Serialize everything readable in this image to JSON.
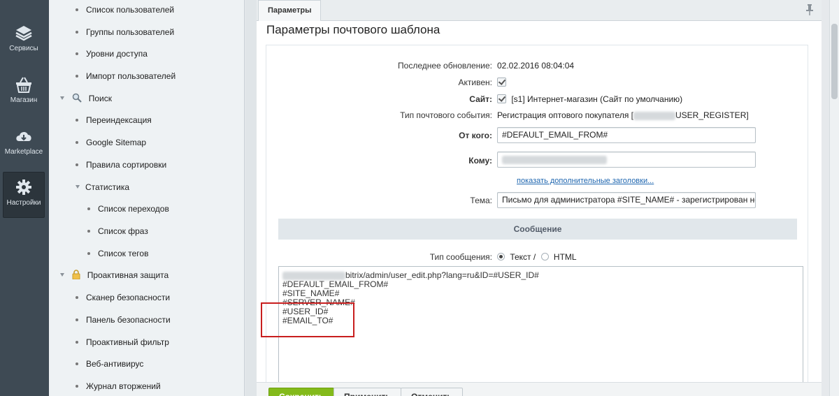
{
  "rail": [
    {
      "label": "Сервисы",
      "icon": "layers-icon"
    },
    {
      "label": "Магазин",
      "icon": "basket-icon"
    },
    {
      "label": "Marketplace",
      "icon": "cloud-download-icon"
    },
    {
      "label": "Настройки",
      "icon": "gear-icon",
      "active": true
    }
  ],
  "menu": [
    "Список пользователей",
    "Группы пользователей",
    "Уровни доступа",
    "Импорт пользователей",
    "Поиск",
    "Переиндексация",
    "Google Sitemap",
    "Правила сортировки",
    "Статистика",
    "Список переходов",
    "Список фраз",
    "Список тегов",
    "Проактивная защита",
    "Сканер безопасности",
    "Панель безопасности",
    "Проактивный фильтр",
    "Веб-антивирус",
    "Журнал вторжений"
  ],
  "tab": {
    "label": "Параметры"
  },
  "form": {
    "title": "Параметры почтового шаблона",
    "last_update_label": "Последнее обновление:",
    "last_update_value": "02.02.2016 08:04:04",
    "active_label": "Активен:",
    "site_label": "Сайт:",
    "site_value": "[s1] Интернет-магазин (Сайт по умолчанию)",
    "event_type_label": "Тип почтового события:",
    "event_type_prefix": "Регистрация оптового покупателя [",
    "event_type_suffix": "USER_REGISTER]",
    "from_label": "От кого:",
    "from_value": "#DEFAULT_EMAIL_FROM#",
    "to_label": "Кому:",
    "more_headers_link": "показать дополнительные заголовки...",
    "subject_label": "Тема:",
    "subject_value": "Письмо для администратора #SITE_NAME# - зарегистрирован нові",
    "message_header": "Сообщение",
    "msg_type_label": "Тип сообщения:",
    "msg_type_text": "Текст /",
    "msg_type_html": "HTML",
    "body_lines": [
      "bitrix/admin/user_edit.php?lang=ru&ID=#USER_ID#",
      "#DEFAULT_EMAIL_FROM#",
      "#SITE_NAME#",
      "#SERVER_NAME#",
      "#USER_ID#",
      "#EMAIL_TO#"
    ]
  },
  "buttons": {
    "save": "Сохранить",
    "apply": "Применить",
    "cancel": "Отменить"
  },
  "colors": {
    "rail": "#3e4a54",
    "save": "#83ba1b",
    "highlight": "#c81e1e",
    "link": "#2067b0"
  }
}
